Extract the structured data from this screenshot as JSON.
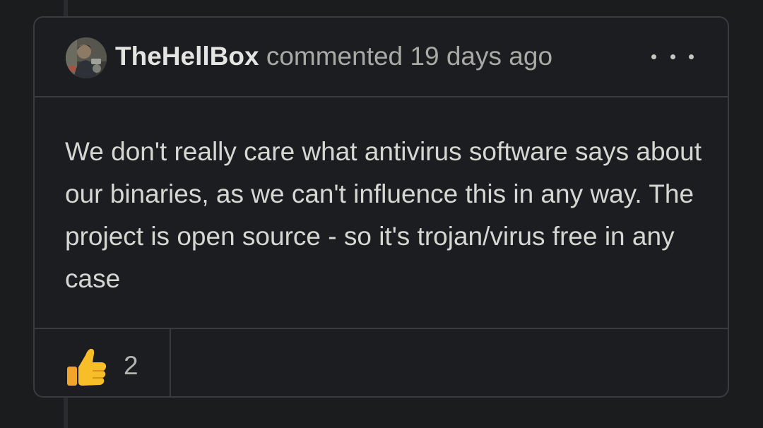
{
  "comment": {
    "author": "TheHellBox",
    "action": "commented",
    "timestamp": "19 days ago",
    "avatar_icon": "user-avatar",
    "menu_icon": "more-horizontal-icon",
    "body": "We don't really care what antivirus software says about our binaries, as we can't influence this in any way. The project is open source - so it's trojan/virus free in any case",
    "reactions": [
      {
        "emoji_name": "thumbs-up-icon",
        "count": "2"
      }
    ]
  },
  "colors": {
    "background": "#1b1c1e",
    "card": "#1c1d20",
    "border": "#3a3b3f",
    "author_text": "#e4e4e2",
    "meta_text": "#a9a9a6",
    "body_text": "#d6d6d3",
    "thumbs_yellow": "#f7be2a"
  }
}
